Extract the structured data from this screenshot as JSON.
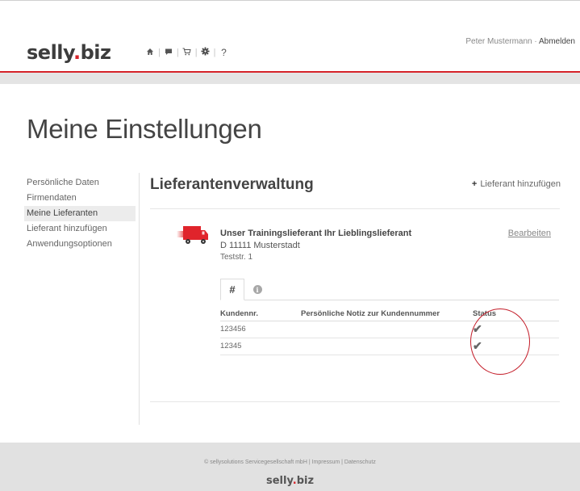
{
  "header": {
    "logo_text": "selly",
    "logo_dot": ".",
    "logo_suffix": "biz",
    "icons": [
      "home-icon",
      "chat-icon",
      "cart-icon",
      "gear-icon",
      "help-icon"
    ],
    "help_label": "?",
    "user_name": "Peter Mustermann",
    "separator": "·",
    "logout_label": "Abmelden"
  },
  "page": {
    "title": "Meine Einstellungen"
  },
  "sidebar": {
    "items": [
      {
        "label": "Persönliche Daten"
      },
      {
        "label": "Firmendaten"
      },
      {
        "label": "Meine Lieferanten",
        "active": true
      },
      {
        "label": "Lieferant hinzufügen"
      },
      {
        "label": "Anwendungsoptionen"
      }
    ]
  },
  "main": {
    "section_title": "Lieferantenverwaltung",
    "add_label": "Lieferant hinzufügen",
    "supplier": {
      "name": "Unser Trainingslieferant Ihr Lieblingslieferant",
      "city": "D 11111 Musterstadt",
      "street": "Teststr. 1",
      "edit_label": "Bearbeiten"
    },
    "tabs": [
      {
        "label": "#"
      },
      {
        "label": "i"
      }
    ],
    "table": {
      "headers": [
        "Kundennr.",
        "Persönliche Notiz zur Kundennummer",
        "Status"
      ],
      "rows": [
        {
          "kundennr": "123456",
          "notiz": "",
          "status": "✔"
        },
        {
          "kundennr": "12345",
          "notiz": "",
          "status": "✔"
        }
      ]
    }
  },
  "footer": {
    "links_text": "© sellysolutions Servicegesellschaft mbH | Impressum | Datenschutz",
    "logo_text": "selly",
    "logo_dot": ".",
    "logo_suffix": "biz"
  },
  "colors": {
    "brand_red": "#d6232a",
    "check_green": "#6f9e1a",
    "annotation": "#c41e2a"
  }
}
